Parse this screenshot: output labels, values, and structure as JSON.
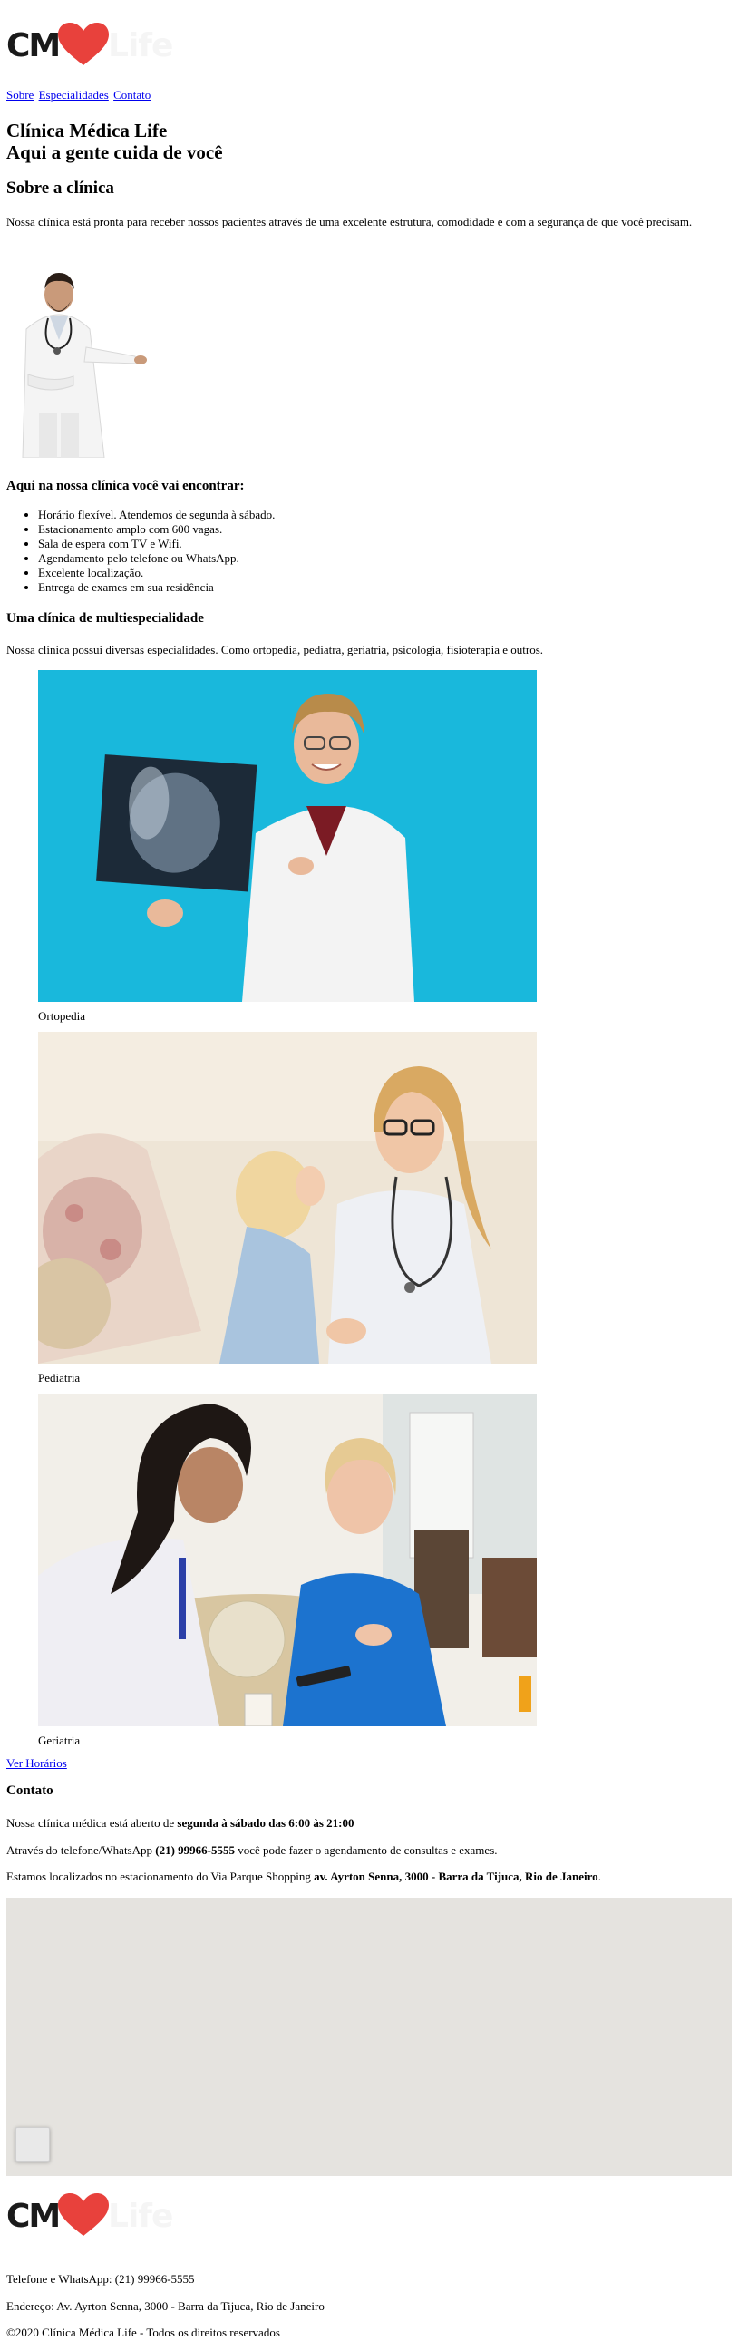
{
  "brand": {
    "logo_letters": "CM",
    "logo_suffix": "Life",
    "heart_color": "#e8413c"
  },
  "nav": {
    "items": [
      "Sobre",
      "Especialidades",
      "Contato"
    ]
  },
  "hero": {
    "title": "Clínica Médica Life",
    "subtitle": "Aqui a gente cuida de você"
  },
  "about": {
    "heading": "Sobre a clínica",
    "text": "Nossa clínica está pronta para receber nossos pacientes através de uma excelente estrutura, comodidade e com a segurança de que você precisam."
  },
  "features": {
    "heading": "Aqui na nossa clínica você vai encontrar:",
    "items": [
      "Horário flexível. Atendemos de segunda à sábado.",
      "Estacionamento amplo com 600 vagas.",
      "Sala de espera com TV e Wifi.",
      "Agendamento pelo telefone ou WhatsApp.",
      "Excelente localização.",
      "Entrega de exames em sua residência"
    ]
  },
  "specialties": {
    "heading": "Uma clínica de multiespecialidade",
    "text": "Nossa clínica possui diversas especialidades. Como ortopedia, pediatra, geriatria, psicologia, fisioterapia e outros.",
    "items": [
      {
        "label": "Ortopedia"
      },
      {
        "label": "Pediatria"
      },
      {
        "label": "Geriatria"
      }
    ],
    "link": "Ver Horários"
  },
  "contact": {
    "heading": "Contato",
    "hours_prefix": "Nossa clínica médica está aberto de ",
    "hours_bold": "segunda à sábado das 6:00 às 21:00",
    "phone_prefix": "Através do telefone/WhatsApp ",
    "phone_bold": "(21) 99966-5555",
    "phone_suffix": " você pode fazer o agendamento de consultas e exames.",
    "address_prefix": "Estamos localizados no estacionamento do Via Parque Shopping ",
    "address_bold": "av. Ayrton Senna, 3000 - Barra da Tijuca, Rio de Janeiro",
    "address_suffix": "."
  },
  "footer": {
    "phone": "Telefone e WhatsApp: (21) 99966-5555",
    "address": "Endereço: Av. Ayrton Senna, 3000 - Barra da Tijuca, Rio de Janeiro",
    "copyright": "©2020 Clínica Médica Life - Todos os direitos reservados"
  }
}
